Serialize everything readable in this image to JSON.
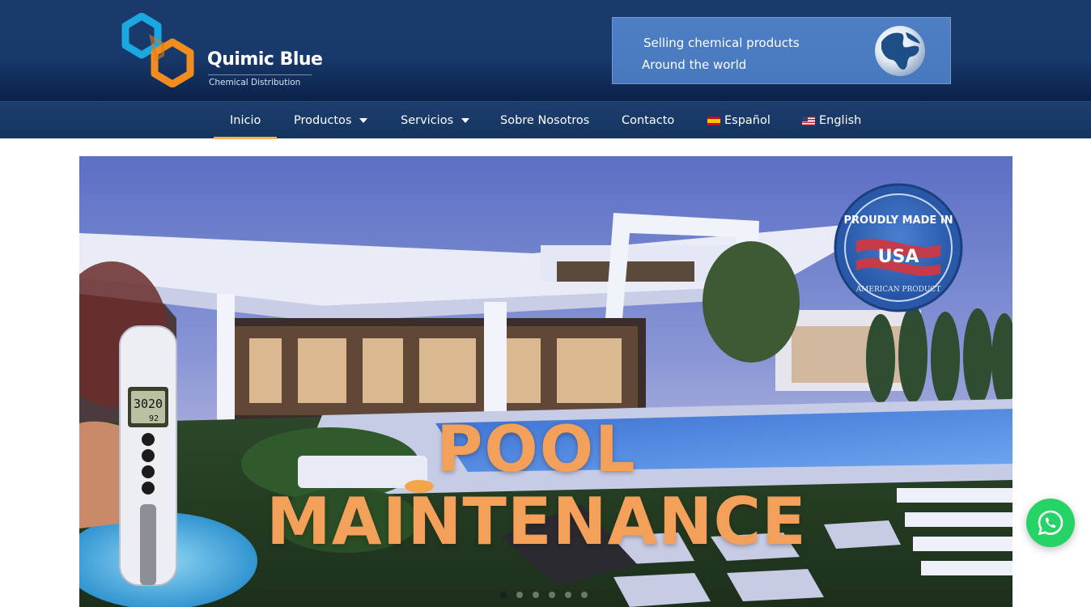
{
  "brand": {
    "name": "Quimic Blue",
    "tagline": "Chemical Distribution"
  },
  "promo": {
    "line1": "Selling chemical products",
    "line2": "Around the world",
    "icon": "globe-icon"
  },
  "nav": {
    "items": [
      {
        "label": "Inicio",
        "active": true
      },
      {
        "label": "Productos",
        "dropdown": true
      },
      {
        "label": "Servicios",
        "dropdown": true
      },
      {
        "label": "Sobre Nosotros"
      },
      {
        "label": "Contacto"
      },
      {
        "label": "Español",
        "icon": "spain-flag-icon"
      },
      {
        "label": "English",
        "icon": "us-flag-icon"
      }
    ]
  },
  "hero": {
    "title_line1": "POOL",
    "title_line2": "MAINTENANCE",
    "title_color": "#f3a05a",
    "meter_reading": "3020",
    "meter_sub": "92",
    "badge": {
      "top_text": "PROUDLY MADE IN",
      "center_text": "USA",
      "bottom_text": "AMERICAN PRODUCT"
    },
    "slide_count": 6,
    "active_slide": 1
  },
  "chat_button": {
    "icon": "whatsapp-icon",
    "color": "#26d366"
  },
  "colors": {
    "header_bg": "#18396b",
    "promo_bg": "#4e7fc4",
    "nav_active_underline": "#f0b35a"
  }
}
